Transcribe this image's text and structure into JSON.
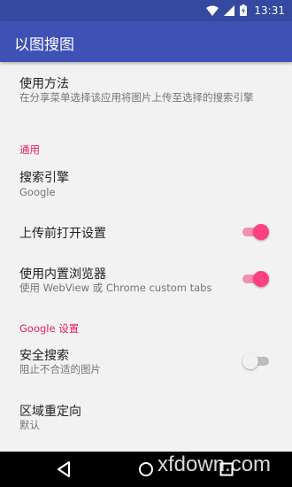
{
  "status_bar": {
    "time": "13:31",
    "icons": [
      "wifi-icon",
      "signal-icon",
      "battery-charging-icon"
    ]
  },
  "app_bar": {
    "title": "以图搜图"
  },
  "preferences": {
    "usage": {
      "title": "使用方法",
      "summary": "在分享菜单选择该应用将图片上传至选择的搜索引擎"
    },
    "category_general": "通用",
    "search_engine": {
      "title": "搜索引擎",
      "summary": "Google"
    },
    "open_settings_before_upload": {
      "title": "上传前打开设置",
      "checked": true
    },
    "builtin_browser": {
      "title": "使用内置浏览器",
      "summary": "使用 WebView 或 Chrome custom tabs",
      "checked": true
    },
    "category_google": "Google 设置",
    "safe_search": {
      "title": "安全搜索",
      "summary": "阻止不合适的图片",
      "checked": false
    },
    "region_redirect": {
      "title": "区域重定向",
      "summary": "默认"
    }
  },
  "nav_bar": {
    "icons": [
      "back-icon",
      "home-icon",
      "recents-icon"
    ]
  },
  "watermark": "xfdown.com",
  "colors": {
    "primary": "#3f51b5",
    "primary_dark": "#3549a0",
    "accent": "#ff4081",
    "background": "#f2f2f2"
  }
}
